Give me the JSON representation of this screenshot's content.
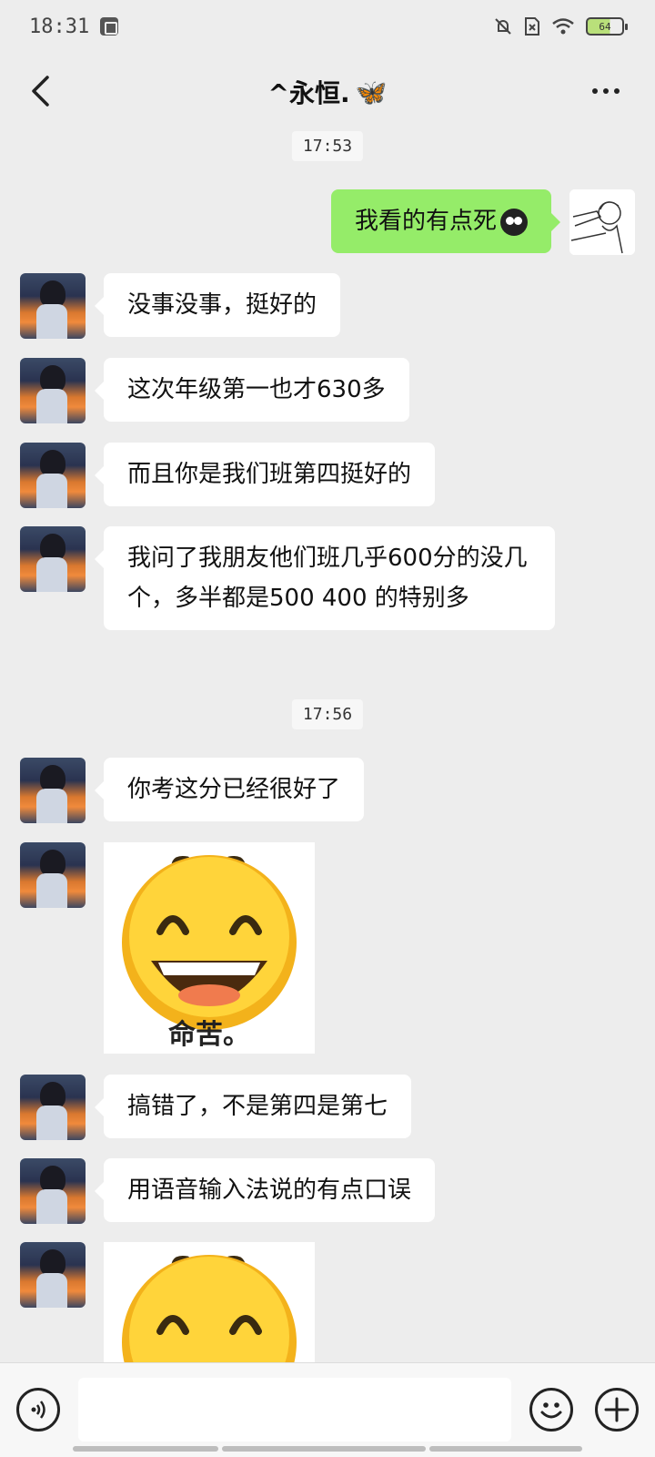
{
  "status_bar": {
    "time": "18:31",
    "battery": "64"
  },
  "header": {
    "title": "^永恒.",
    "title_emoji": "🦋",
    "back_icon": "chevron-left-icon",
    "more_icon": "more-dots-icon"
  },
  "messages": {
    "timestamp_1": "17:53",
    "timestamp_2": "17:56",
    "self_1": "我看的有点死",
    "other_1": "没事没事，挺好的",
    "other_2": "这次年级第一也才630多",
    "other_3": "而且你是我们班第四挺好的",
    "other_4": "我问了我朋友他们班几乎600分的没几个，多半都是500 400 的特别多",
    "other_5": "你考这分已经很好了",
    "sticker_caption": "命苦。",
    "other_6": "搞错了，不是第四是第七",
    "other_7": "用语音输入法说的有点口误"
  },
  "input_bar": {
    "placeholder": "",
    "voice_icon": "voice-icon",
    "emoji_icon": "emoji-icon",
    "plus_icon": "plus-icon"
  },
  "colors": {
    "self_bubble": "#95ec69",
    "other_bubble": "#ffffff",
    "background": "#ededed"
  }
}
